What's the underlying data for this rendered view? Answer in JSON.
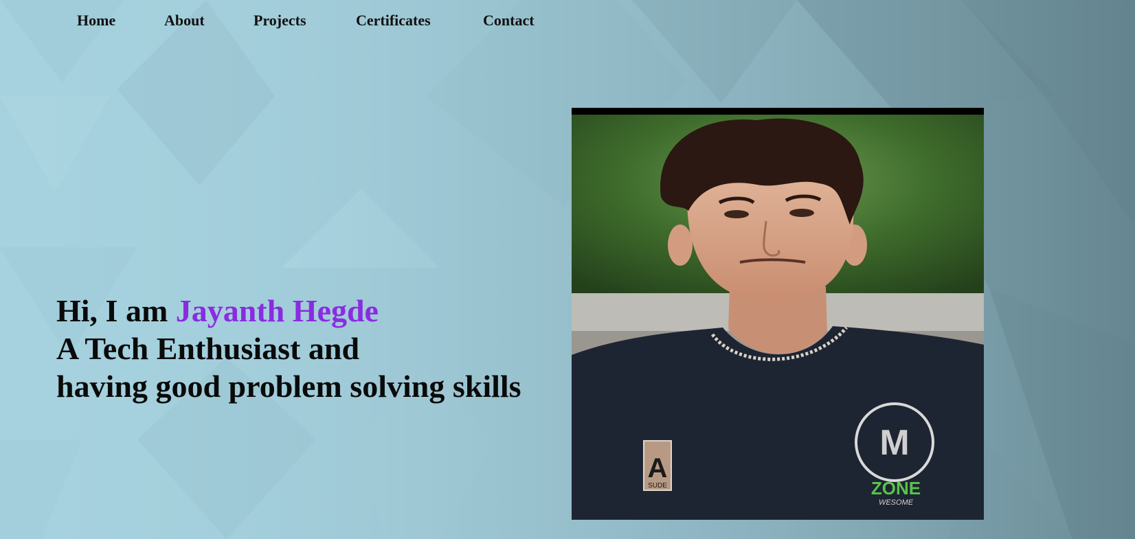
{
  "nav": {
    "items": [
      {
        "label": "Home"
      },
      {
        "label": "About"
      },
      {
        "label": "Projects"
      },
      {
        "label": "Certificates"
      },
      {
        "label": "Contact"
      }
    ]
  },
  "hero": {
    "greeting": "Hi, I am ",
    "name": "Jayanth Hegde",
    "line2": "A Tech Enthusiast and",
    "line3": "having good problem solving skills"
  },
  "photo": {
    "shirt_badge_left": "SUDE",
    "shirt_logo_text": "ZONE",
    "shirt_logo_subtext": "WESOME"
  },
  "colors": {
    "background": "#a4d0dd",
    "accent_name": "#8a2be2",
    "text": "#0a0a0a"
  }
}
